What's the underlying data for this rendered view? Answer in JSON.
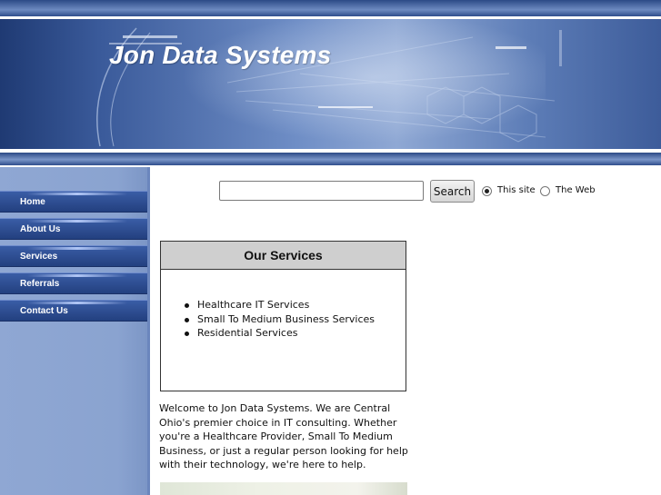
{
  "header": {
    "site_title": "Jon Data Systems"
  },
  "nav": {
    "items": [
      {
        "label": "Home"
      },
      {
        "label": "About Us"
      },
      {
        "label": "Services"
      },
      {
        "label": "Referrals"
      },
      {
        "label": "Contact Us"
      }
    ]
  },
  "search": {
    "input_value": "",
    "button_label": "Search",
    "options": [
      {
        "label": "This site",
        "selected": true
      },
      {
        "label": "The Web",
        "selected": false
      }
    ]
  },
  "services": {
    "heading": "Our Services",
    "items": [
      "Healthcare IT Services",
      "Small To Medium Business Services",
      "Residential Services"
    ]
  },
  "welcome": {
    "text": "Welcome to Jon Data Systems.  We are Central Ohio's premier choice in IT consulting.  Whether you're a Healthcare Provider, Small To Medium Business, or just a regular person looking for help with their technology, we're here to help."
  },
  "colors": {
    "banner_blue": "#3a5a9a",
    "nav_blue": "#2c4a8c",
    "sidebar_blue": "#8fa7d3",
    "header_gray": "#cfcfcf"
  }
}
